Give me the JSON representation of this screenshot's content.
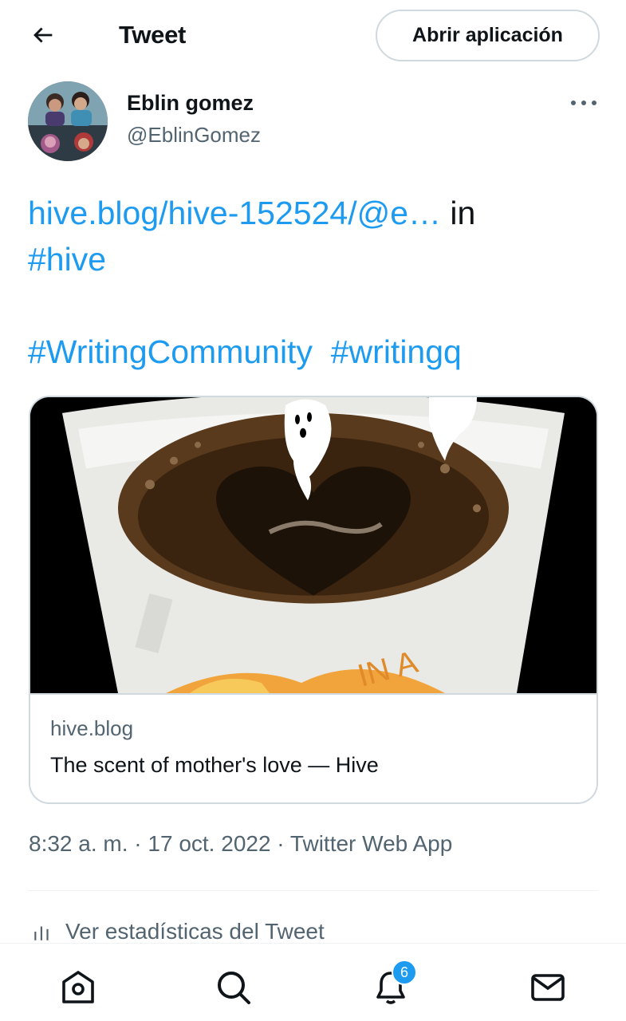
{
  "header": {
    "back_icon": "arrow-left-icon",
    "title": "Tweet",
    "open_app_label": "Abrir aplicación"
  },
  "author": {
    "display_name": "Eblin gomez",
    "handle": "@EblinGomez",
    "more_icon": "more-horizontal-icon"
  },
  "tweet": {
    "link_text": "hive.blog/hive-152524/@e…",
    "in_text": " in",
    "hashtag_hive": "#hive",
    "hashtag_writingcommunity": "#WritingCommunity",
    "hashtag_writingq": "#writingq"
  },
  "card": {
    "domain": "hive.blog",
    "title": "The scent of mother's love — Hive"
  },
  "meta": {
    "time": "8:32 a. m.",
    "sep1": " · ",
    "date": "17 oct. 2022",
    "sep2": " · ",
    "source": "Twitter Web App"
  },
  "stats": {
    "icon": "bar-chart-icon",
    "label": "Ver estadísticas del Tweet"
  },
  "bottom_nav": {
    "home_icon": "home-icon",
    "search_icon": "search-icon",
    "notifications_icon": "bell-icon",
    "notifications_count": "6",
    "messages_icon": "mail-icon"
  },
  "colors": {
    "accent": "#1d9bf0",
    "text": "#0f1419",
    "secondary": "#536471",
    "border": "#cfd9de"
  }
}
